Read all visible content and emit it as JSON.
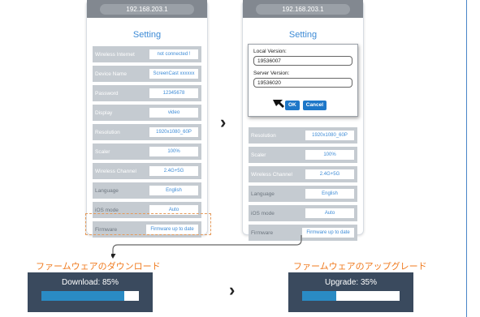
{
  "url": "192.168.203.1",
  "screen_title": "Setting",
  "left_rows": [
    {
      "label": "Wireless Internet",
      "value": "not connected !"
    },
    {
      "label": "Device Name",
      "value": "ScreenCast xxxxxx"
    },
    {
      "label": "Password",
      "value": "12345678"
    },
    {
      "label": "Display",
      "value": "video"
    },
    {
      "label": "Resolution",
      "value": "1920x1080_60P"
    },
    {
      "label": "Scaler",
      "value": "100%"
    },
    {
      "label": "Wireless Channel",
      "value": "2.4G+5G"
    },
    {
      "label": "Language",
      "value": "English"
    },
    {
      "label": "iOS mode",
      "value": "Auto"
    },
    {
      "label": "Firmware",
      "value": "Firmware up to date"
    }
  ],
  "right_rows": [
    {
      "label": "Resolution",
      "value": "1920x1080_60P"
    },
    {
      "label": "Scaler",
      "value": "100%"
    },
    {
      "label": "Wireless Channel",
      "value": "2.4G+5G"
    },
    {
      "label": "Language",
      "value": "English"
    },
    {
      "label": "iOS mode",
      "value": "Auto"
    },
    {
      "label": "Firmware",
      "value": "Firmware up to date"
    }
  ],
  "dialog": {
    "local_label": "Local Version:",
    "local_value": "19536007",
    "server_label": "Server Version:",
    "server_value": "19536020",
    "ok_label": "OK",
    "cancel_label": "Cancel"
  },
  "download": {
    "caption": "ファームウェアのダウンロード",
    "status": "Download: 85%",
    "progress": 0.85
  },
  "upgrade": {
    "caption": "ファームウェアのアップグレード",
    "status": "Upgrade: 35%",
    "progress": 0.35
  },
  "colors": {
    "accent": "#3d8bd6",
    "caption": "#f07a1e",
    "panel": "#3a4a5e",
    "progress": "#2a8bc4",
    "button": "#1e77c8"
  }
}
